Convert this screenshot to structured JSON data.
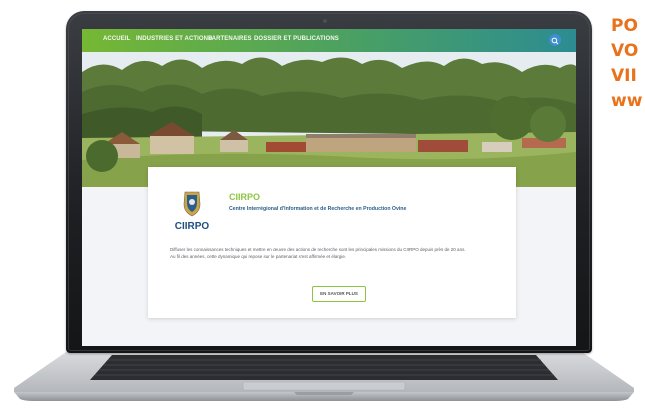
{
  "promo": {
    "lines": [
      "PO",
      "VO",
      "VII",
      "ww"
    ],
    "color": "#e8731c"
  },
  "site": {
    "nav": {
      "items": [
        "ACCUEIL",
        "INDUSTRIES ET ACTIONS",
        "PARTENAIRES",
        "DOSSIER ET PUBLICATIONS"
      ],
      "search_icon": "search-icon"
    },
    "card": {
      "logo_text": "CIIRPO",
      "title": "CIIRPO",
      "subtitle": "Centre Interrégional d'Information et de Recherche en Production Ovine",
      "body_1": "Diffuser les connaissances techniques et mettre en œuvre des actions de recherche sont les principales missions du CIIRPO depuis près de 20 ans.",
      "body_2": "Au fil des années, cette dynamique qui repose sur le partenariat s'est affirmée et élargie.",
      "more_button": "EN SAVOIR PLUS"
    }
  },
  "colors": {
    "accent_green": "#8cc63f",
    "navy": "#2a5d87",
    "nav_start": "#76b734",
    "nav_end": "#2c8c92"
  }
}
